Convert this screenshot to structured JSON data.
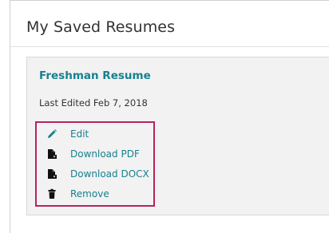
{
  "page": {
    "title": "My Saved Resumes"
  },
  "resume_card": {
    "title": "Freshman Resume",
    "last_edited": "Last Edited Feb 7, 2018",
    "actions": [
      {
        "label": "Edit",
        "icon": "pencil-icon"
      },
      {
        "label": "Download PDF",
        "icon": "file-download-icon"
      },
      {
        "label": "Download DOCX",
        "icon": "file-download-icon"
      },
      {
        "label": "Remove",
        "icon": "trash-icon"
      }
    ]
  },
  "colors": {
    "accent": "#17808f",
    "highlight_border": "#b8225e",
    "card_background": "#f2f2f2",
    "text": "#333333"
  }
}
